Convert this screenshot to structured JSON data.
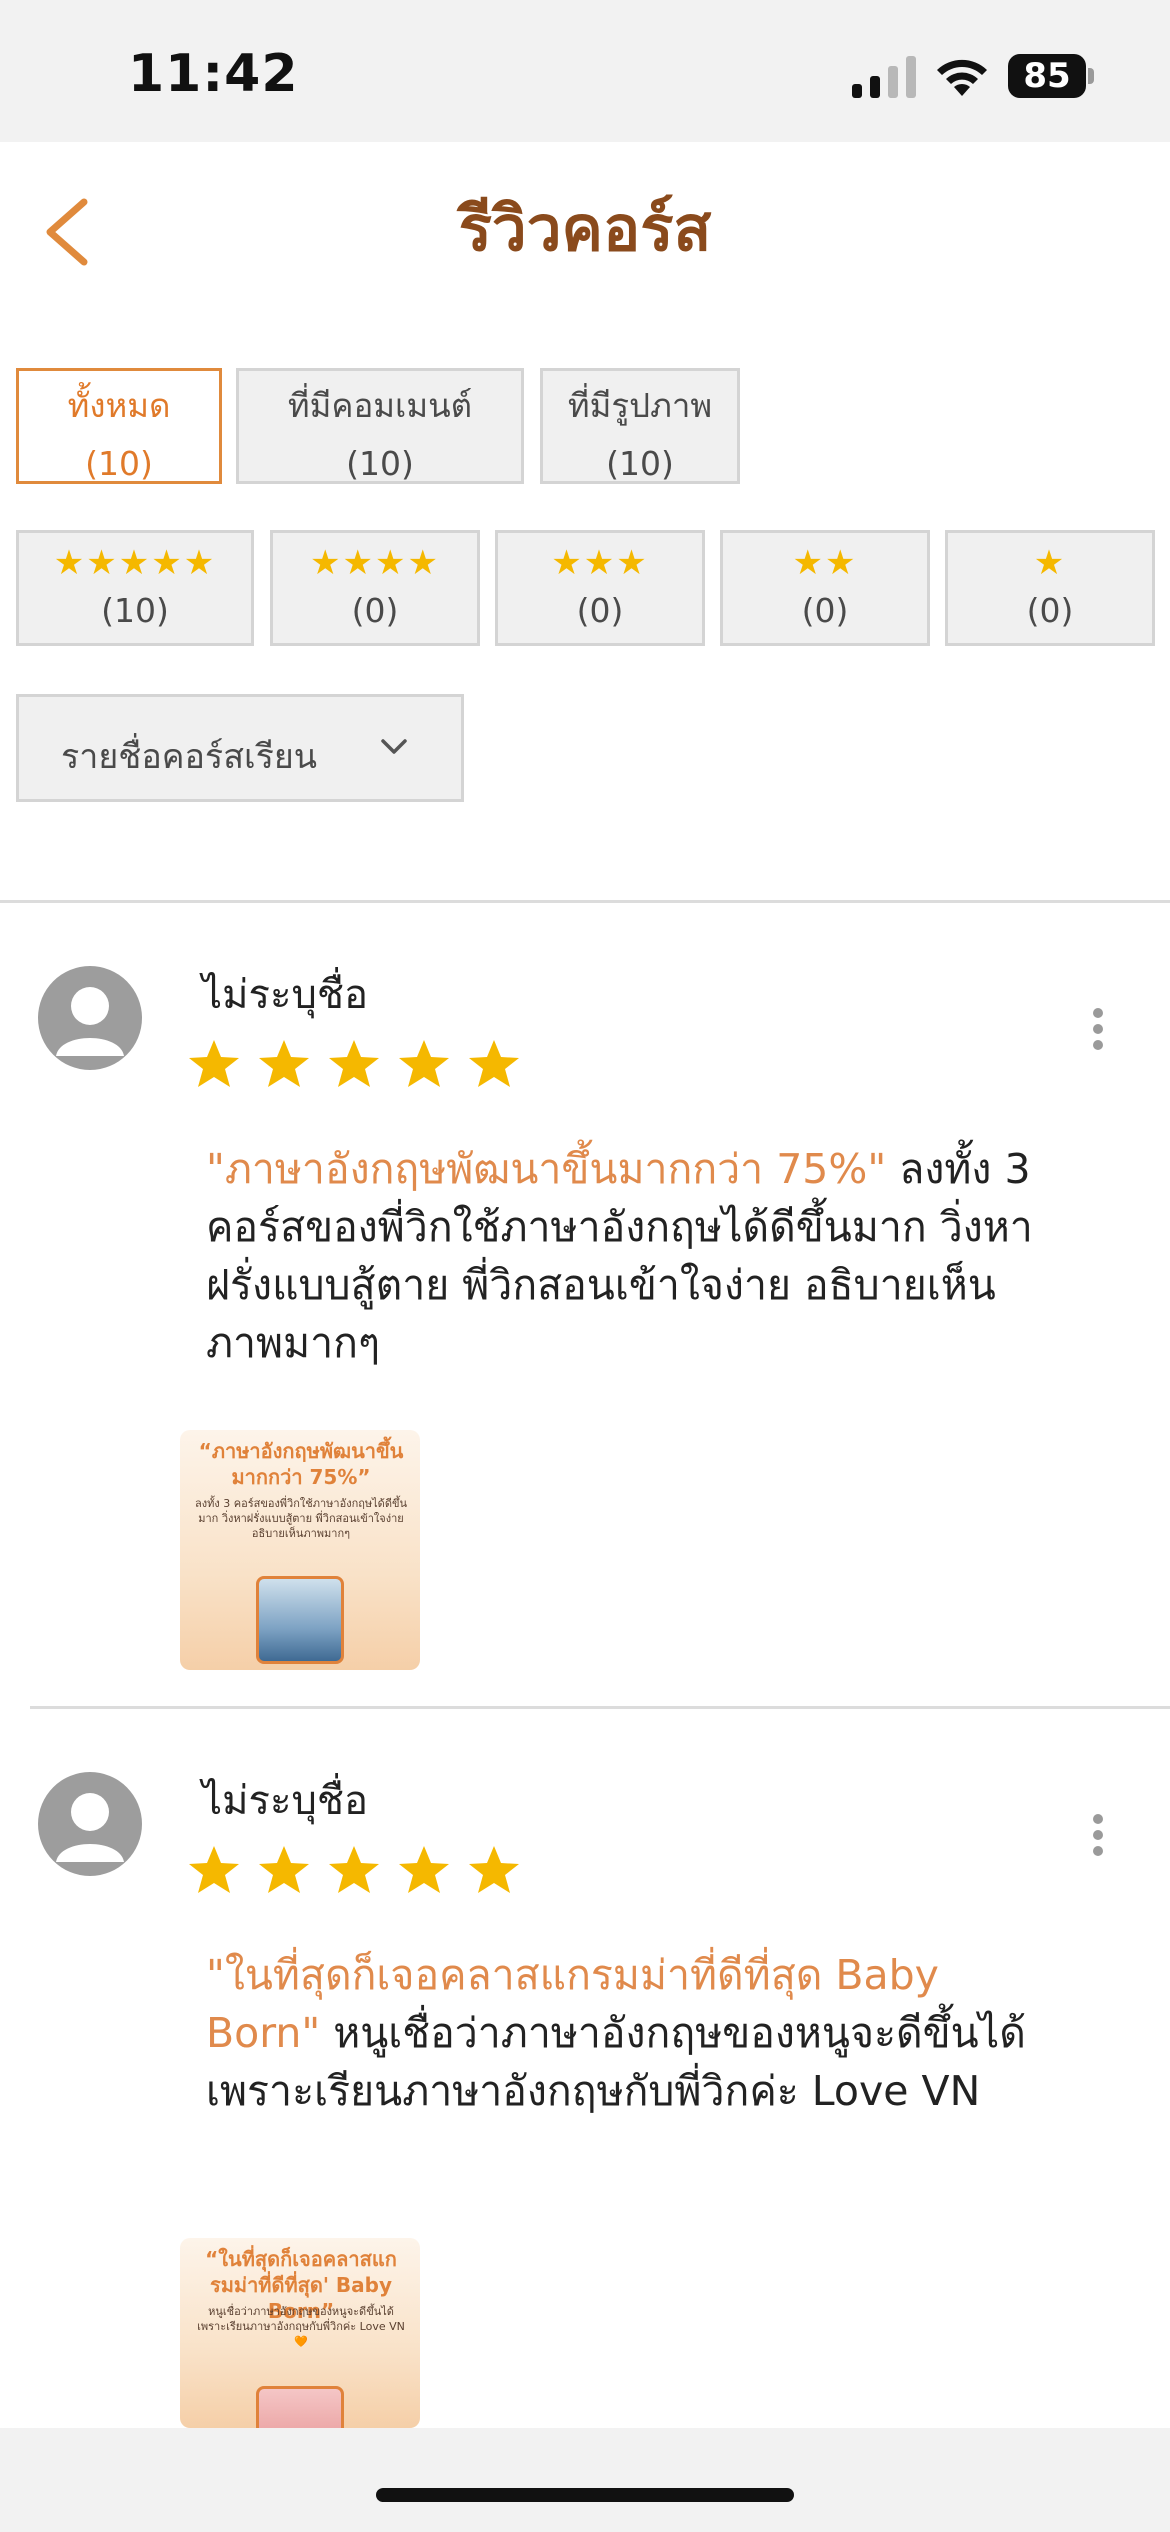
{
  "status_bar": {
    "time": "11:42",
    "battery": "85"
  },
  "header": {
    "title": "รีวิวคอร์ส"
  },
  "tabs": [
    {
      "label": "ทั้งหมด",
      "count": "(10)"
    },
    {
      "label": "ที่มีคอมเมนต์",
      "count": "(10)"
    },
    {
      "label": "ที่มีรูปภาพ",
      "count": "(10)"
    }
  ],
  "star_filters": [
    {
      "stars": "★★★★★",
      "count": "(10)"
    },
    {
      "stars": "★★★★",
      "count": "(0)"
    },
    {
      "stars": "★★★",
      "count": "(0)"
    },
    {
      "stars": "★★",
      "count": "(0)"
    },
    {
      "stars": "★",
      "count": "(0)"
    }
  ],
  "course_select": {
    "label": "รายชื่อคอร์สเรียน"
  },
  "colors": {
    "accent": "#e08a3c",
    "title": "#8a4a1c",
    "star": "#f5b800"
  },
  "reviews": [
    {
      "name": "ไม่ระบุชื่อ",
      "rating": 5,
      "quote": "\"ภาษาอังกฤษพัฒนาขึ้นมากกว่า 75%\"",
      "text": " ลงทั้ง 3 คอร์สของพี่วิกใช้ภาษาอังกฤษได้ดีขึ้นมาก วิ่งหาฝรั่งแบบสู้ตาย พี่วิกสอนเข้าใจง่าย อธิบายเห็นภาพมากๆ",
      "photo_quote": "“ภาษาอังกฤษพัฒนาขึ้นมากกว่า 75%”",
      "photo_body": "ลงทั้ง 3 คอร์สของพี่วิกใช้ภาษาอังกฤษได้ดีขึ้นมาก วิ่งหาฝรั่งแบบสู้ตาย พี่วิกสอนเข้าใจง่าย อธิบายเห็นภาพมากๆ"
    },
    {
      "name": "ไม่ระบุชื่อ",
      "rating": 5,
      "quote": "\"ในที่สุดก็เจอคลาสแกรมม่าที่ดีที่สุด Baby Born\"",
      "text": " หนูเชื่อว่าภาษาอังกฤษของหนูจะดีขึ้นได้เพราะเรียนภาษาอังกฤษกับพี่วิกค่ะ Love VN",
      "photo_quote": "“ในที่สุดก็เจอคลาสแกรมม่าที่ดีที่สุด' Baby Born”",
      "photo_body": "หนูเชื่อว่าภาษาอังกฤษของหนูจะดีขึ้นได้ เพราะเรียนภาษาอังกฤษกับพี่วิกค่ะ Love VN🧡"
    }
  ]
}
